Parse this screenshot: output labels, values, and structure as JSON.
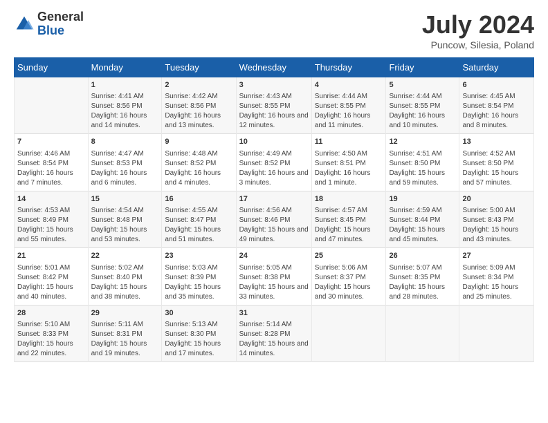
{
  "logo": {
    "general": "General",
    "blue": "Blue"
  },
  "header": {
    "month": "July 2024",
    "location": "Puncow, Silesia, Poland"
  },
  "days_of_week": [
    "Sunday",
    "Monday",
    "Tuesday",
    "Wednesday",
    "Thursday",
    "Friday",
    "Saturday"
  ],
  "weeks": [
    [
      {
        "day": "",
        "sunrise": "",
        "sunset": "",
        "daylight": ""
      },
      {
        "day": "1",
        "sunrise": "Sunrise: 4:41 AM",
        "sunset": "Sunset: 8:56 PM",
        "daylight": "Daylight: 16 hours and 14 minutes."
      },
      {
        "day": "2",
        "sunrise": "Sunrise: 4:42 AM",
        "sunset": "Sunset: 8:56 PM",
        "daylight": "Daylight: 16 hours and 13 minutes."
      },
      {
        "day": "3",
        "sunrise": "Sunrise: 4:43 AM",
        "sunset": "Sunset: 8:55 PM",
        "daylight": "Daylight: 16 hours and 12 minutes."
      },
      {
        "day": "4",
        "sunrise": "Sunrise: 4:44 AM",
        "sunset": "Sunset: 8:55 PM",
        "daylight": "Daylight: 16 hours and 11 minutes."
      },
      {
        "day": "5",
        "sunrise": "Sunrise: 4:44 AM",
        "sunset": "Sunset: 8:55 PM",
        "daylight": "Daylight: 16 hours and 10 minutes."
      },
      {
        "day": "6",
        "sunrise": "Sunrise: 4:45 AM",
        "sunset": "Sunset: 8:54 PM",
        "daylight": "Daylight: 16 hours and 8 minutes."
      }
    ],
    [
      {
        "day": "7",
        "sunrise": "Sunrise: 4:46 AM",
        "sunset": "Sunset: 8:54 PM",
        "daylight": "Daylight: 16 hours and 7 minutes."
      },
      {
        "day": "8",
        "sunrise": "Sunrise: 4:47 AM",
        "sunset": "Sunset: 8:53 PM",
        "daylight": "Daylight: 16 hours and 6 minutes."
      },
      {
        "day": "9",
        "sunrise": "Sunrise: 4:48 AM",
        "sunset": "Sunset: 8:52 PM",
        "daylight": "Daylight: 16 hours and 4 minutes."
      },
      {
        "day": "10",
        "sunrise": "Sunrise: 4:49 AM",
        "sunset": "Sunset: 8:52 PM",
        "daylight": "Daylight: 16 hours and 3 minutes."
      },
      {
        "day": "11",
        "sunrise": "Sunrise: 4:50 AM",
        "sunset": "Sunset: 8:51 PM",
        "daylight": "Daylight: 16 hours and 1 minute."
      },
      {
        "day": "12",
        "sunrise": "Sunrise: 4:51 AM",
        "sunset": "Sunset: 8:50 PM",
        "daylight": "Daylight: 15 hours and 59 minutes."
      },
      {
        "day": "13",
        "sunrise": "Sunrise: 4:52 AM",
        "sunset": "Sunset: 8:50 PM",
        "daylight": "Daylight: 15 hours and 57 minutes."
      }
    ],
    [
      {
        "day": "14",
        "sunrise": "Sunrise: 4:53 AM",
        "sunset": "Sunset: 8:49 PM",
        "daylight": "Daylight: 15 hours and 55 minutes."
      },
      {
        "day": "15",
        "sunrise": "Sunrise: 4:54 AM",
        "sunset": "Sunset: 8:48 PM",
        "daylight": "Daylight: 15 hours and 53 minutes."
      },
      {
        "day": "16",
        "sunrise": "Sunrise: 4:55 AM",
        "sunset": "Sunset: 8:47 PM",
        "daylight": "Daylight: 15 hours and 51 minutes."
      },
      {
        "day": "17",
        "sunrise": "Sunrise: 4:56 AM",
        "sunset": "Sunset: 8:46 PM",
        "daylight": "Daylight: 15 hours and 49 minutes."
      },
      {
        "day": "18",
        "sunrise": "Sunrise: 4:57 AM",
        "sunset": "Sunset: 8:45 PM",
        "daylight": "Daylight: 15 hours and 47 minutes."
      },
      {
        "day": "19",
        "sunrise": "Sunrise: 4:59 AM",
        "sunset": "Sunset: 8:44 PM",
        "daylight": "Daylight: 15 hours and 45 minutes."
      },
      {
        "day": "20",
        "sunrise": "Sunrise: 5:00 AM",
        "sunset": "Sunset: 8:43 PM",
        "daylight": "Daylight: 15 hours and 43 minutes."
      }
    ],
    [
      {
        "day": "21",
        "sunrise": "Sunrise: 5:01 AM",
        "sunset": "Sunset: 8:42 PM",
        "daylight": "Daylight: 15 hours and 40 minutes."
      },
      {
        "day": "22",
        "sunrise": "Sunrise: 5:02 AM",
        "sunset": "Sunset: 8:40 PM",
        "daylight": "Daylight: 15 hours and 38 minutes."
      },
      {
        "day": "23",
        "sunrise": "Sunrise: 5:03 AM",
        "sunset": "Sunset: 8:39 PM",
        "daylight": "Daylight: 15 hours and 35 minutes."
      },
      {
        "day": "24",
        "sunrise": "Sunrise: 5:05 AM",
        "sunset": "Sunset: 8:38 PM",
        "daylight": "Daylight: 15 hours and 33 minutes."
      },
      {
        "day": "25",
        "sunrise": "Sunrise: 5:06 AM",
        "sunset": "Sunset: 8:37 PM",
        "daylight": "Daylight: 15 hours and 30 minutes."
      },
      {
        "day": "26",
        "sunrise": "Sunrise: 5:07 AM",
        "sunset": "Sunset: 8:35 PM",
        "daylight": "Daylight: 15 hours and 28 minutes."
      },
      {
        "day": "27",
        "sunrise": "Sunrise: 5:09 AM",
        "sunset": "Sunset: 8:34 PM",
        "daylight": "Daylight: 15 hours and 25 minutes."
      }
    ],
    [
      {
        "day": "28",
        "sunrise": "Sunrise: 5:10 AM",
        "sunset": "Sunset: 8:33 PM",
        "daylight": "Daylight: 15 hours and 22 minutes."
      },
      {
        "day": "29",
        "sunrise": "Sunrise: 5:11 AM",
        "sunset": "Sunset: 8:31 PM",
        "daylight": "Daylight: 15 hours and 19 minutes."
      },
      {
        "day": "30",
        "sunrise": "Sunrise: 5:13 AM",
        "sunset": "Sunset: 8:30 PM",
        "daylight": "Daylight: 15 hours and 17 minutes."
      },
      {
        "day": "31",
        "sunrise": "Sunrise: 5:14 AM",
        "sunset": "Sunset: 8:28 PM",
        "daylight": "Daylight: 15 hours and 14 minutes."
      },
      {
        "day": "",
        "sunrise": "",
        "sunset": "",
        "daylight": ""
      },
      {
        "day": "",
        "sunrise": "",
        "sunset": "",
        "daylight": ""
      },
      {
        "day": "",
        "sunrise": "",
        "sunset": "",
        "daylight": ""
      }
    ]
  ]
}
